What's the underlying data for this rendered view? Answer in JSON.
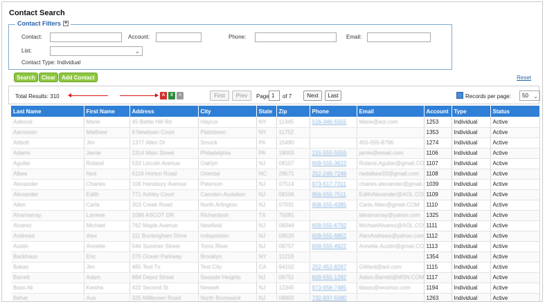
{
  "page": {
    "title": "Contact Search"
  },
  "filters": {
    "legend": "Contact Filters",
    "expand": "+",
    "contact_label": "Contact:",
    "account_label": "Account:",
    "phone_label": "Phone:",
    "email_label": "Email:",
    "list_label": "List:",
    "contact_type": "Contact Type: Individual",
    "contact_value": "",
    "account_value": "",
    "phone_value": "",
    "email_value": "",
    "list_value": ""
  },
  "actions": {
    "search": "Search",
    "clear": "Clear",
    "add_contact": "Add Contact",
    "reset": "Reset"
  },
  "results": {
    "total": "Total Results: 310",
    "export_icons": [
      "pdf-icon",
      "excel-icon",
      "csv-icon"
    ],
    "first": "First",
    "prev": "Prev",
    "page_label": "Page",
    "page_value": "1",
    "of_label": "of 7",
    "next": "Next",
    "last": "Last",
    "rpp_label": "Records per page:",
    "rpp_value": "50"
  },
  "columns": [
    "Last Name",
    "First Name",
    "Address",
    "City",
    "State",
    "Zip",
    "Phone",
    "Email",
    "Account",
    "Type",
    "Status"
  ],
  "rows": [
    [
      "Aabood",
      "Marie",
      "45 Battle Hill Rd",
      "Haycor",
      "NY",
      "11345",
      "516-346-5555",
      "Marie@aol.com",
      "1253",
      "Individual",
      "Active"
    ],
    [
      "Aaronson",
      "Matthew",
      "9 Newtown Court",
      "Plattstown",
      "NY",
      "11752",
      "",
      "",
      "1353",
      "Individual",
      "Active"
    ],
    [
      "Abbott",
      "Jim",
      "1377 Allen Dr",
      "Smock",
      "PA",
      "15480",
      "",
      "455-555-8796",
      "1274",
      "Individual",
      "Active"
    ],
    [
      "Adams",
      "Jamie",
      "2314 Main Street",
      "Philadelphia",
      "PA",
      "19003",
      "215-555-5555",
      "jamie@email.com",
      "1106",
      "Individual",
      "Active"
    ],
    [
      "Aguilar",
      "Roland",
      "533 Lincoln Avenue",
      "Oaklyn",
      "NJ",
      "08107",
      "609-555-3622",
      "Roland.Aguilar@gmail.COM",
      "1107",
      "Individual",
      "Active"
    ],
    [
      "Albee",
      "Ned",
      "6116 Horton Road",
      "Oriental",
      "NC",
      "28571",
      "252-249-7249",
      "nedalbee33@gmail.com",
      "1108",
      "Individual",
      "Active"
    ],
    [
      "Alexander",
      "Charles",
      "106 Hansbury Avenue",
      "Paterson",
      "NJ",
      "07514",
      "973-517-7311",
      "charles.alexander@gmail.com",
      "1039",
      "Individual",
      "Active"
    ],
    [
      "Alexander",
      "Edith",
      "771 Ashley Court",
      "Camden-Audubon",
      "NJ",
      "08106",
      "856-555-7511",
      "EdithAlexander@AOL.COM",
      "1109",
      "Individual",
      "Active"
    ],
    [
      "Allen",
      "Carla",
      "303 Creek Road",
      "North Arlington",
      "NJ",
      "07031",
      "908-555-4385",
      "Carla.Allen@gmail.COM",
      "1110",
      "Individual",
      "Active"
    ],
    [
      "Alvamarray",
      "Larrese",
      "1086 ASCOT DR",
      "Richardson",
      "TX",
      "75081",
      "",
      "lalvamarray@yahoo.com",
      "1325",
      "Individual",
      "Active"
    ],
    [
      "Alvarez",
      "Michael",
      "762 Maple Avenue",
      "Newfield",
      "NJ",
      "08344",
      "609-555-6792",
      "MichaelAlvarez@AOL.COM",
      "1111",
      "Individual",
      "Active"
    ],
    [
      "Andrews",
      "Alex",
      "111 Buckingham Drive",
      "Indapstown",
      "NJ",
      "08520",
      "609-555-6852",
      "AlexAndrews@yahoo.com",
      "1112",
      "Individual",
      "Active"
    ],
    [
      "Austin",
      "Annette",
      "544 Summer Street",
      "Toms River",
      "NJ",
      "08757",
      "609-555-4622",
      "Annette.Austin@gmail.COM",
      "1113",
      "Individual",
      "Active"
    ],
    [
      "Backhaus",
      "Eric",
      "375 Ocean Parkway",
      "Brooklyn",
      "NY",
      "11218",
      "",
      "",
      "1354",
      "Individual",
      "Active"
    ],
    [
      "Bakas",
      "Jim",
      "485 Test Tx",
      "Test City",
      "CA",
      "94102",
      "252-452-8297",
      "GWard@aol.com",
      "1115",
      "Individual",
      "Active"
    ],
    [
      "Barrett",
      "Adam",
      "884 Depot Street",
      "Seaside Heights",
      "NJ",
      "08751",
      "609-555-1282",
      "Adam.Barrett@MSN.COM",
      "1117",
      "Individual",
      "Active"
    ],
    [
      "Bass Ali",
      "Keisha",
      "422 Second St",
      "Newark",
      "NJ",
      "12345",
      "973-658-7485",
      "kbass@woohoo.com",
      "1194",
      "Individual",
      "Active"
    ],
    [
      "Behar",
      "Ava",
      "325 Millbrown Road",
      "North Brunswick",
      "NJ",
      "08902",
      "732-937-5080",
      "",
      "1263",
      "Individual",
      "Active"
    ]
  ]
}
